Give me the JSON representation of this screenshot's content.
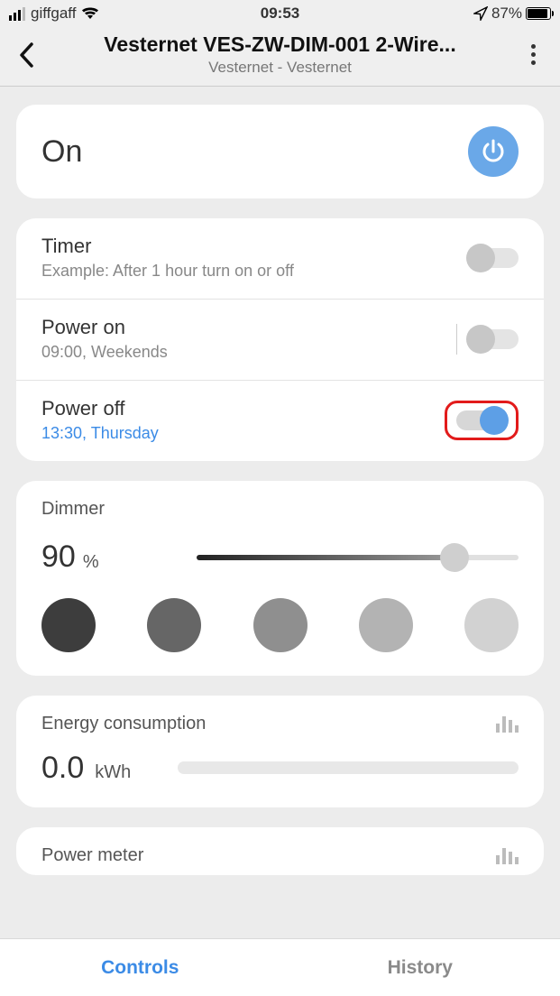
{
  "status": {
    "carrier": "giffgaff",
    "time": "09:53",
    "battery_pct": "87%"
  },
  "header": {
    "title": "Vesternet VES-ZW-DIM-001 2-Wire...",
    "subtitle": "Vesternet - Vesternet"
  },
  "on_card": {
    "state_label": "On"
  },
  "schedule": {
    "timer": {
      "title": "Timer",
      "sub": "Example: After 1 hour turn on or off"
    },
    "power_on": {
      "title": "Power on",
      "sub": "09:00, Weekends"
    },
    "power_off": {
      "title": "Power off",
      "sub": "13:30, Thursday"
    }
  },
  "dimmer": {
    "label": "Dimmer",
    "value": "90",
    "unit": "%",
    "shades": [
      "#3d3d3d",
      "#666666",
      "#8f8f8f",
      "#b3b3b3",
      "#d2d2d2"
    ]
  },
  "energy": {
    "label": "Energy consumption",
    "value": "0.0",
    "unit": "kWh"
  },
  "meter": {
    "label": "Power meter"
  },
  "tabs": {
    "controls": "Controls",
    "history": "History"
  }
}
